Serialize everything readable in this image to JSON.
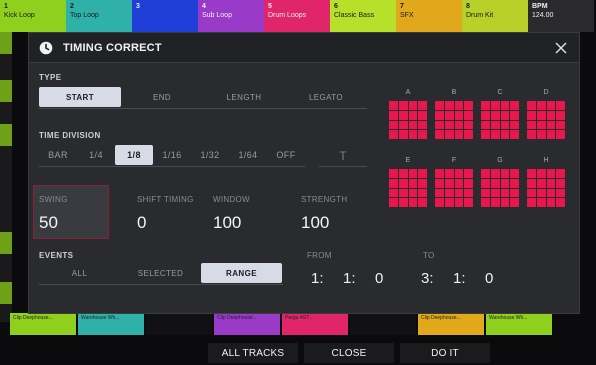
{
  "background": {
    "tracks": [
      {
        "num": "1",
        "name": "Kick Loop",
        "color": "#8fcf1e"
      },
      {
        "num": "2",
        "name": "Top Loop",
        "color": "#2fb0a8"
      },
      {
        "num": "3",
        "name": "",
        "color": "#1f3fd8"
      },
      {
        "num": "4",
        "name": "Sub Loop",
        "color": "#9a3ac8"
      },
      {
        "num": "5",
        "name": "Drum Loops",
        "color": "#e0256a"
      },
      {
        "num": "6",
        "name": "Classic Bass",
        "color": "#b7e02a"
      },
      {
        "num": "7",
        "name": "SFX",
        "color": "#e0a81a"
      },
      {
        "num": "8",
        "name": "Drum Kit",
        "color": "#b7d12a"
      },
      {
        "num": "BPM",
        "name": "124.00",
        "color": "#2a2a2d"
      }
    ],
    "clips": [
      {
        "label": "Clip Deephouse...",
        "color": "#8fcf1e"
      },
      {
        "label": "Warehouse Wh...",
        "color": "#2fb0a8"
      },
      {
        "label": "",
        "color": "#111114"
      },
      {
        "label": "Clip Deephouse...",
        "color": "#9a3ac8"
      },
      {
        "label": "Perga 4G7...",
        "color": "#e0256a"
      },
      {
        "label": "",
        "color": "#111114"
      },
      {
        "label": "Clip Deephouse...",
        "color": "#e0a81a"
      },
      {
        "label": "Warehouse Wh...",
        "color": "#8fcf1e"
      }
    ]
  },
  "dialog": {
    "title": "TIMING CORRECT",
    "type": {
      "label": "TYPE",
      "options": [
        "START",
        "END",
        "LENGTH",
        "LEGATO"
      ],
      "selected": "START"
    },
    "time_division": {
      "label": "TIME DIVISION",
      "options": [
        "BAR",
        "1/4",
        "1/8",
        "1/16",
        "1/32",
        "1/64",
        "OFF"
      ],
      "selected": "1/8",
      "triplet_label": "T"
    },
    "params": {
      "swing": {
        "label": "SWING",
        "value": "50"
      },
      "shift_timing": {
        "label": "SHIFT TIMING",
        "value": "0"
      },
      "window": {
        "label": "WINDOW",
        "value": "100"
      },
      "strength": {
        "label": "STRENGTH",
        "value": "100"
      }
    },
    "events": {
      "label": "EVENTS",
      "options": [
        "ALL",
        "SELECTED",
        "RANGE"
      ],
      "selected": "RANGE"
    },
    "range": {
      "from_label": "FROM",
      "to_label": "TO",
      "from": [
        "1:",
        "1:",
        "0"
      ],
      "to": [
        "3:",
        "1:",
        "0"
      ]
    },
    "pad_banks": [
      "A",
      "B",
      "C",
      "D",
      "E",
      "F",
      "G",
      "H"
    ],
    "pad_color": "#e8174d"
  },
  "bottom_bar": {
    "all_tracks": "ALL TRACKS",
    "close": "CLOSE",
    "do_it": "DO IT"
  }
}
